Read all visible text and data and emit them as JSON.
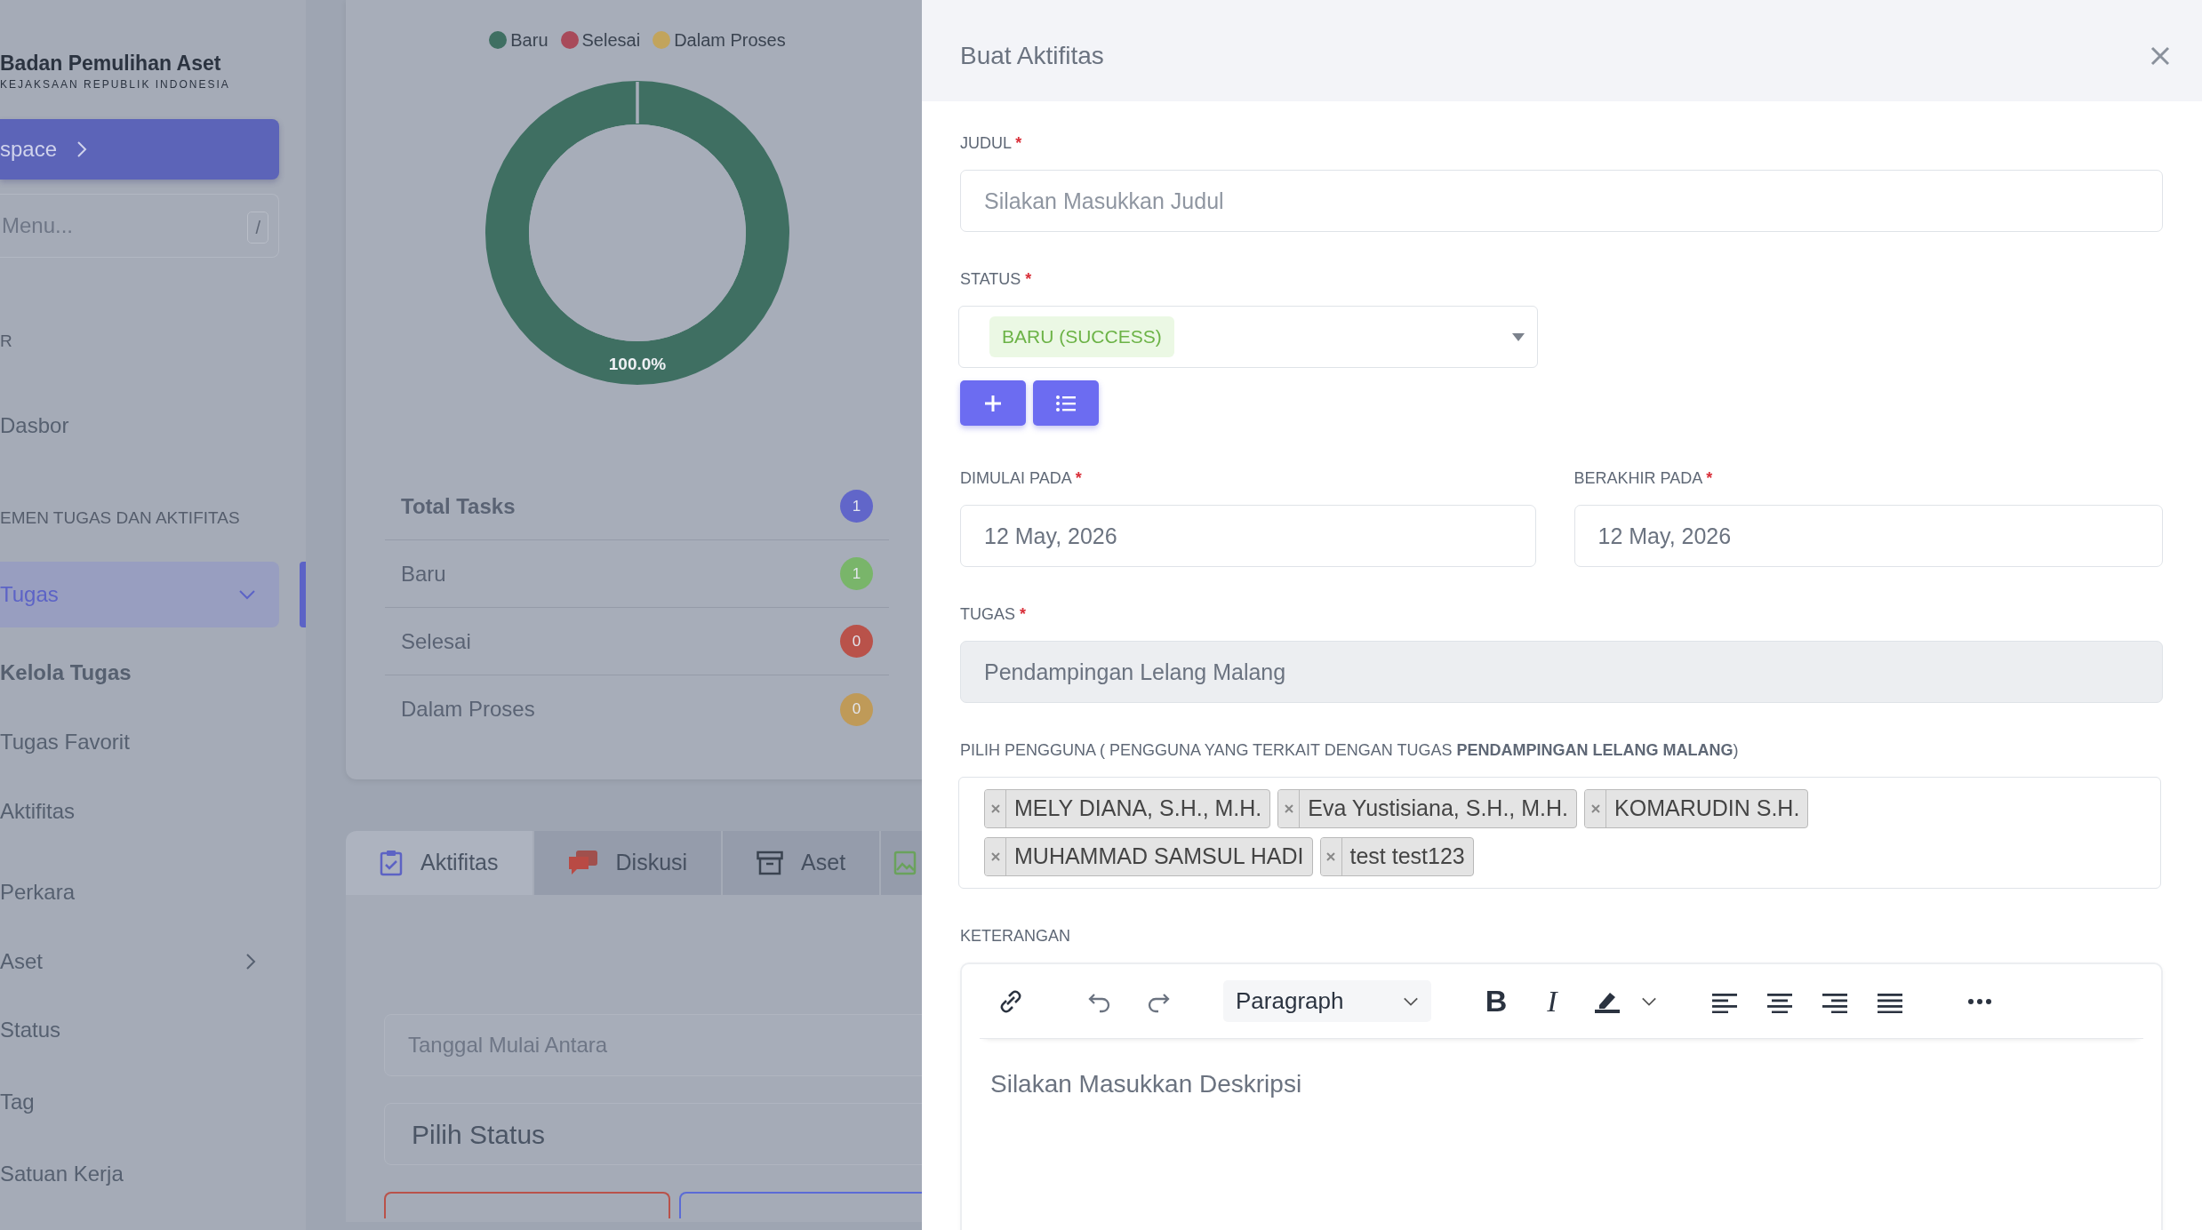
{
  "sidebar": {
    "brand": {
      "title": "Badan Pemulihan Aset",
      "subtitle": "KEJAKSAAN REPUBLIK INDONESIA"
    },
    "workspace_button": "space",
    "search": {
      "placeholder": "Menu...",
      "shortcut": "/"
    },
    "sections": [
      {
        "label": "R",
        "items": [
          {
            "label": "Dasbor",
            "kind": "link"
          }
        ]
      },
      {
        "label": "EMEN TUGAS DAN AKTIFITAS",
        "items": [
          {
            "label": "Tugas",
            "kind": "group",
            "selected": true,
            "expanded": true,
            "children": [
              {
                "label": "Kelola Tugas",
                "selected": true
              },
              {
                "label": "Tugas Favorit",
                "selected": false
              },
              {
                "label": "Aktifitas",
                "selected": false
              }
            ]
          },
          {
            "label": "Perkara",
            "kind": "link"
          },
          {
            "label": "Aset",
            "kind": "group",
            "selected": false,
            "expanded": false
          },
          {
            "label": "Status",
            "kind": "link"
          },
          {
            "label": "Tag",
            "kind": "link"
          },
          {
            "label": "Satuan Kerja",
            "kind": "link"
          }
        ]
      }
    ]
  },
  "summary_card": {
    "chart_data": {
      "type": "donut",
      "categories": [
        "Baru",
        "Selesai",
        "Dalam Proses"
      ],
      "values": [
        1,
        0,
        0
      ],
      "value_labels": [
        "100.0%",
        null,
        null
      ]
    },
    "slice_colors": [
      {
        "color": "#3f6f62"
      },
      {
        "color": "#a84a5a"
      },
      {
        "color": "#c2a45c"
      }
    ],
    "rows": [
      {
        "kind": "total",
        "label": "Total Tasks",
        "count": "1",
        "color": "#6166c9"
      },
      {
        "kind": "status",
        "label": "Baru",
        "count": "1",
        "color": "#79b56a"
      },
      {
        "kind": "status",
        "label": "Selesai",
        "count": "0",
        "color": "#b9524a"
      },
      {
        "kind": "status",
        "label": "Dalam Proses",
        "count": "0",
        "color": "#bf9a58"
      }
    ]
  },
  "tabs": [
    {
      "label": "Aktifitas",
      "selected": true
    },
    {
      "label": "Diskusi",
      "selected": false
    },
    {
      "label": "Aset",
      "selected": false
    },
    {
      "selected": false
    }
  ],
  "filters": {
    "date_placeholder": "Tanggal Mulai Antara",
    "status_select": "Pilih Status"
  },
  "action_buttons": [
    {
      "color": "#b9524a"
    },
    {
      "color": "#5b6bd6"
    }
  ],
  "dialog": {
    "title": "Buat Aktifitas",
    "judul": {
      "label": "JUDUL",
      "required_mark": "*",
      "placeholder": "Silakan Masukkan Judul"
    },
    "status": {
      "label": "STATUS",
      "required_mark": "*",
      "value": "BARU (SUCCESS)"
    },
    "start": {
      "label": "DIMULAI PADA",
      "required_mark": "*",
      "value": "12 May, 2026"
    },
    "end": {
      "label": "BERAKHIR PADA",
      "required_mark": "*",
      "value": "12 May, 2026"
    },
    "tugas": {
      "label": "TUGAS",
      "required_mark": "*",
      "value": "Pendampingan Lelang Malang",
      "disabled": true
    },
    "users": {
      "label": "PILIH PENGGUNA ( PENGGUNA YANG TERKAIT DENGAN TUGAS **PENDAMPINGAN LELANG MALANG**)",
      "tags": [
        "MELY DIANA, S.H., M.H.",
        "Eva Yustisiana, S.H., M.H.",
        "KOMARUDIN S.H.",
        "MUHAMMAD SAMSUL HADI",
        "test test123"
      ]
    },
    "keterangan": {
      "label": "KETERANGAN",
      "block_format": "Paragraph",
      "bold": "B",
      "italic": "I",
      "placeholder": "Silakan Masukkan Deskripsi"
    }
  }
}
